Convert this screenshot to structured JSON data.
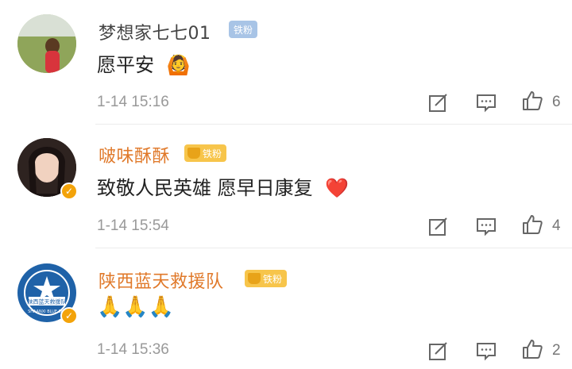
{
  "comments": [
    {
      "username": "梦想家七七01",
      "badge": "铁粉",
      "text": "愿平安",
      "emoji": "🙆",
      "time": "1-14 15:16",
      "likes": "6"
    },
    {
      "username": "啵味酥酥",
      "badge": "铁粉",
      "text": "致敬人民英雄 愿早日康复",
      "emoji": "❤️",
      "time": "1-14 15:54",
      "likes": "4"
    },
    {
      "username": "陕西蓝天救援队",
      "badge": "铁粉",
      "text": "🙏🙏🙏",
      "time": "1-14 15:36",
      "likes": "2",
      "avatar_text": "陕西蓝天救援队",
      "avatar_subtext": "SHAANXI BLUE SKY"
    }
  ],
  "colors": {
    "vip_name": "#e0792a",
    "normal_name": "#444444",
    "badge_blue": "#a8c4e6",
    "badge_gold": "#f7c54b",
    "verified": "#f3a30a"
  }
}
